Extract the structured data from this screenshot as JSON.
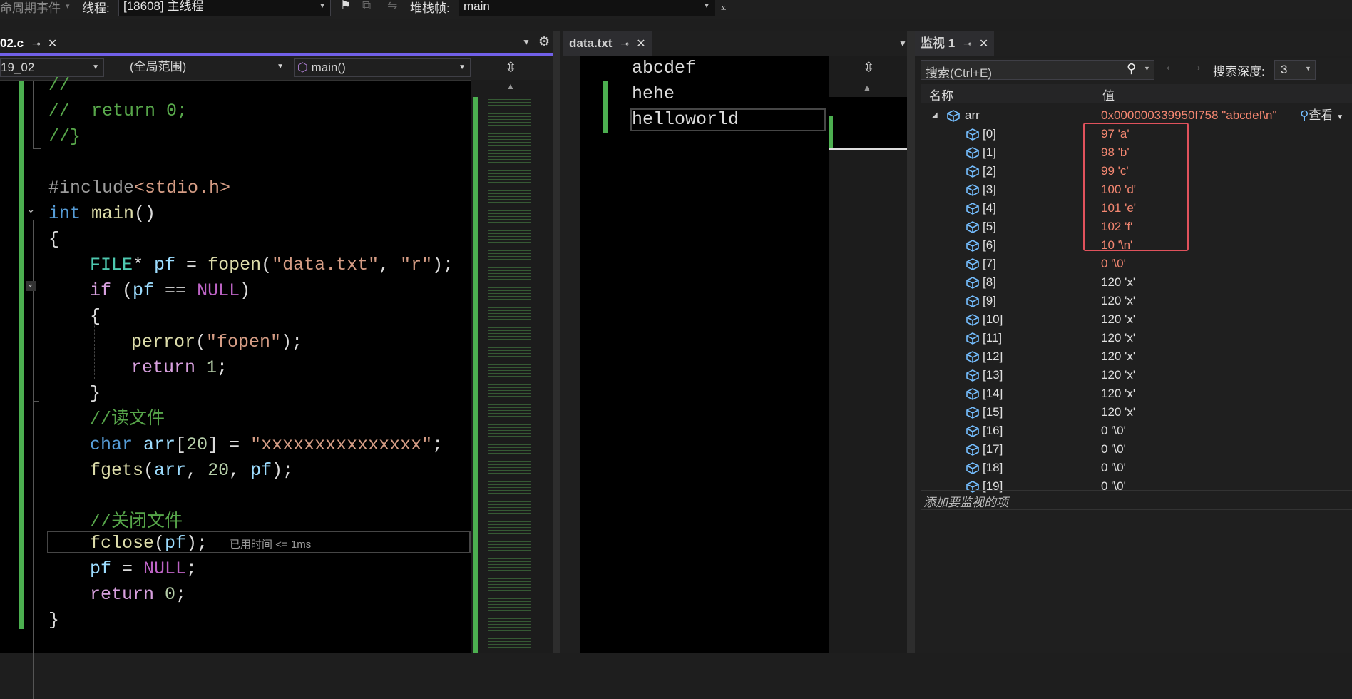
{
  "toolbar": {
    "lifecycle_label": "命周期事件",
    "thread_label": "线程:",
    "thread_value": "[18608] 主线程",
    "stackframe_label": "堆栈帧:",
    "stackframe_value": "main"
  },
  "left_tab": {
    "name": "02.c"
  },
  "left_nav": {
    "project": "19_02",
    "scope": "(全局范围)",
    "func": "main()"
  },
  "mid_tab": {
    "name": "data.txt"
  },
  "data_lines": [
    "abcdef",
    "hehe",
    "helloworld"
  ],
  "code": {
    "l1": "//",
    "l2_cm": "//  return 0;",
    "l3": "//}",
    "l5_pre": "#include",
    "l5_hdr": "<stdio.h>",
    "l6_kw": "int",
    "l6_fn": "main",
    "l6_rest": "()",
    "l7": "{",
    "l8_ty": "FILE",
    "l8_a": "* ",
    "l8_var": "pf",
    "l8_b": " = ",
    "l8_fn": "fopen",
    "l8_c": "(",
    "l8_s1": "\"data.txt\"",
    "l8_d": ", ",
    "l8_s2": "\"r\"",
    "l8_e": ");",
    "l9_kw": "if",
    "l9_a": " (",
    "l9_var": "pf",
    "l9_b": " == ",
    "l9_mac": "NULL",
    "l9_c": ")",
    "l10": "{",
    "l11_fn": "perror",
    "l11_a": "(",
    "l11_s": "\"fopen\"",
    "l11_b": ");",
    "l12_kw": "return",
    "l12_a": " ",
    "l12_num": "1",
    "l12_b": ";",
    "l13": "}",
    "l14_cm": "//读文件",
    "l15_kw": "char",
    "l15_a": " ",
    "l15_var": "arr",
    "l15_b": "[",
    "l15_num": "20",
    "l15_c": "] = ",
    "l15_s": "\"xxxxxxxxxxxxxxx\"",
    "l15_d": ";",
    "l16_fn": "fgets",
    "l16_a": "(",
    "l16_var": "arr",
    "l16_b": ", ",
    "l16_num": "20",
    "l16_c": ", ",
    "l16_var2": "pf",
    "l16_d": ");",
    "l18_cm": "//关闭文件",
    "l19_fn": "fclose",
    "l19_a": "(",
    "l19_var": "pf",
    "l19_b": ");",
    "l19_hint": "已用时间 <= 1ms",
    "l20_var": "pf",
    "l20_a": " = ",
    "l20_mac": "NULL",
    "l20_b": ";",
    "l21_kw": "return",
    "l21_a": " ",
    "l21_num": "0",
    "l21_b": ";",
    "l22": "}"
  },
  "watch": {
    "tab": "监视 1",
    "search_placeholder": "搜索(Ctrl+E)",
    "depth_label": "搜索深度:",
    "depth_value": "3",
    "col_name": "名称",
    "col_value": "值",
    "root_name": "arr",
    "root_value": "0x000000339950f758 \"abcdef\\n\"",
    "view_label": "查看",
    "rows": [
      {
        "name": "[0]",
        "value": "97 'a'"
      },
      {
        "name": "[1]",
        "value": "98 'b'"
      },
      {
        "name": "[2]",
        "value": "99 'c'"
      },
      {
        "name": "[3]",
        "value": "100 'd'"
      },
      {
        "name": "[4]",
        "value": "101 'e'"
      },
      {
        "name": "[5]",
        "value": "102 'f'"
      },
      {
        "name": "[6]",
        "value": "10 '\\n'"
      },
      {
        "name": "[7]",
        "value": "0 '\\0'"
      },
      {
        "name": "[8]",
        "value": "120 'x'"
      },
      {
        "name": "[9]",
        "value": "120 'x'"
      },
      {
        "name": "[10]",
        "value": "120 'x'"
      },
      {
        "name": "[11]",
        "value": "120 'x'"
      },
      {
        "name": "[12]",
        "value": "120 'x'"
      },
      {
        "name": "[13]",
        "value": "120 'x'"
      },
      {
        "name": "[14]",
        "value": "120 'x'"
      },
      {
        "name": "[15]",
        "value": "120 'x'"
      },
      {
        "name": "[16]",
        "value": "0 '\\0'"
      },
      {
        "name": "[17]",
        "value": "0 '\\0'"
      },
      {
        "name": "[18]",
        "value": "0 '\\0'"
      },
      {
        "name": "[19]",
        "value": "0 '\\0'"
      }
    ],
    "add_item": "添加要监视的项"
  },
  "colors": {
    "accent_tab": "#7160e8",
    "changed_value": "#f48771",
    "highlight_box": "#e0525c",
    "change_bar": "#4caf50"
  }
}
